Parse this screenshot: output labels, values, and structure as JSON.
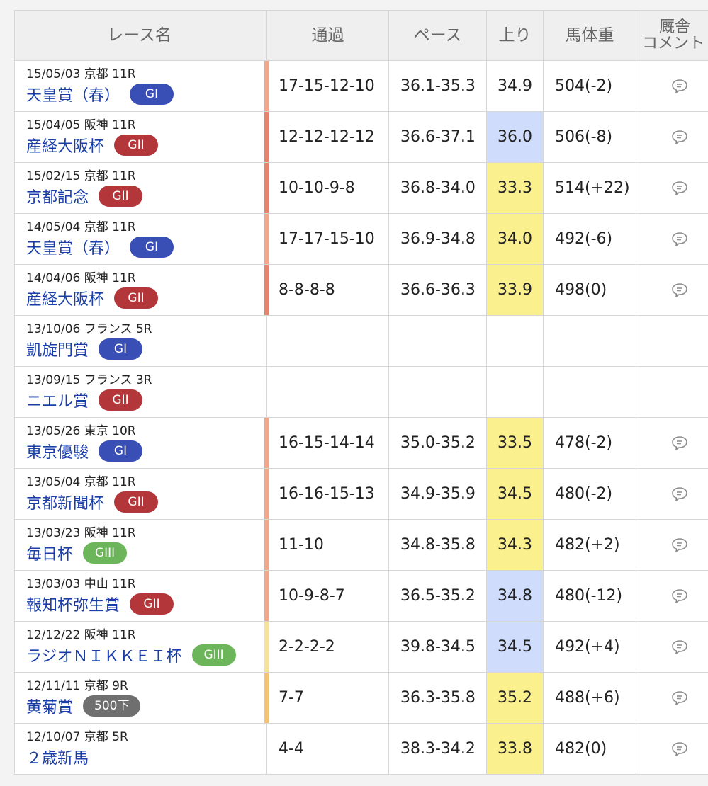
{
  "headers": {
    "race_name": "レース名",
    "passing": "通過",
    "pace": "ペース",
    "last3f": "上り",
    "weight": "馬体重",
    "comment_line1": "厩舎",
    "comment_line2": "コメント"
  },
  "rows": [
    {
      "date": "15/05/03 京都 11R",
      "name": "天皇賞（春）",
      "grade": "GI",
      "grade_class": "g1",
      "stripe": "#f0a78a",
      "passing": "17-15-12-10",
      "pace": "36.1-35.3",
      "last3f": "34.9",
      "last_hl": "",
      "weight": "504(-2)",
      "has_comment": true
    },
    {
      "date": "15/04/05 阪神 11R",
      "name": "産経大阪杯",
      "grade": "GII",
      "grade_class": "g2",
      "stripe": "#e8826b",
      "passing": "12-12-12-12",
      "pace": "36.6-37.1",
      "last3f": "36.0",
      "last_hl": "lo",
      "weight": "506(-8)",
      "has_comment": true
    },
    {
      "date": "15/02/15 京都 11R",
      "name": "京都記念",
      "grade": "GII",
      "grade_class": "g2",
      "stripe": "#e8826b",
      "passing": "10-10-9-8",
      "pace": "36.8-34.0",
      "last3f": "33.3",
      "last_hl": "hi",
      "weight": "514(+22)",
      "has_comment": true
    },
    {
      "date": "14/05/04 京都 11R",
      "name": "天皇賞（春）",
      "grade": "GI",
      "grade_class": "g1",
      "stripe": "#f0a78a",
      "passing": "17-17-15-10",
      "pace": "36.9-34.8",
      "last3f": "34.0",
      "last_hl": "hi",
      "weight": "492(-6)",
      "has_comment": true
    },
    {
      "date": "14/04/06 阪神 11R",
      "name": "産経大阪杯",
      "grade": "GII",
      "grade_class": "g2",
      "stripe": "#e8826b",
      "passing": "8-8-8-8",
      "pace": "36.6-36.3",
      "last3f": "33.9",
      "last_hl": "hi",
      "weight": "498(0)",
      "has_comment": true
    },
    {
      "date": "13/10/06 フランス 5R",
      "name": "凱旋門賞",
      "grade": "GI",
      "grade_class": "g1",
      "stripe": "",
      "passing": "",
      "pace": "",
      "last3f": "",
      "last_hl": "",
      "weight": "",
      "has_comment": false
    },
    {
      "date": "13/09/15 フランス 3R",
      "name": "ニエル賞",
      "grade": "GII",
      "grade_class": "g2",
      "stripe": "",
      "passing": "",
      "pace": "",
      "last3f": "",
      "last_hl": "",
      "weight": "",
      "has_comment": false
    },
    {
      "date": "13/05/26 東京 10R",
      "name": "東京優駿",
      "grade": "GI",
      "grade_class": "g1",
      "stripe": "#f0a78a",
      "passing": "16-15-14-14",
      "pace": "35.0-35.2",
      "last3f": "33.5",
      "last_hl": "hi",
      "weight": "478(-2)",
      "has_comment": true
    },
    {
      "date": "13/05/04 京都 11R",
      "name": "京都新聞杯",
      "grade": "GII",
      "grade_class": "g2",
      "stripe": "#f0a78a",
      "passing": "16-16-15-13",
      "pace": "34.9-35.9",
      "last3f": "34.5",
      "last_hl": "hi",
      "weight": "480(-2)",
      "has_comment": true
    },
    {
      "date": "13/03/23 阪神 11R",
      "name": "毎日杯",
      "grade": "GIII",
      "grade_class": "g3",
      "stripe": "#f0a78a",
      "passing": "11-10",
      "pace": "34.8-35.8",
      "last3f": "34.3",
      "last_hl": "hi",
      "weight": "482(+2)",
      "has_comment": true
    },
    {
      "date": "13/03/03 中山 11R",
      "name": "報知杯弥生賞",
      "grade": "GII",
      "grade_class": "g2",
      "stripe": "#f0a78a",
      "passing": "10-9-8-7",
      "pace": "36.5-35.2",
      "last3f": "34.8",
      "last_hl": "lo",
      "weight": "480(-12)",
      "has_comment": true
    },
    {
      "date": "12/12/22 阪神 11R",
      "name": "ラジオＮＩＫＫＥＩ杯",
      "grade": "GIII",
      "grade_class": "g3",
      "stripe": "#f6e39a",
      "passing": "2-2-2-2",
      "pace": "39.8-34.5",
      "last3f": "34.5",
      "last_hl": "lo",
      "weight": "492(+4)",
      "has_comment": true
    },
    {
      "date": "12/11/11 京都 9R",
      "name": "黄菊賞",
      "grade": "500下",
      "grade_class": "cond",
      "stripe": "#f5c470",
      "passing": "7-7",
      "pace": "36.3-35.8",
      "last3f": "35.2",
      "last_hl": "hi",
      "weight": "488(+6)",
      "has_comment": true
    },
    {
      "date": "12/10/07 京都 5R",
      "name": "２歳新馬",
      "grade": "",
      "grade_class": "",
      "stripe": "",
      "passing": "4-4",
      "pace": "38.3-34.2",
      "last3f": "33.8",
      "last_hl": "hi",
      "weight": "482(0)",
      "has_comment": true
    }
  ]
}
